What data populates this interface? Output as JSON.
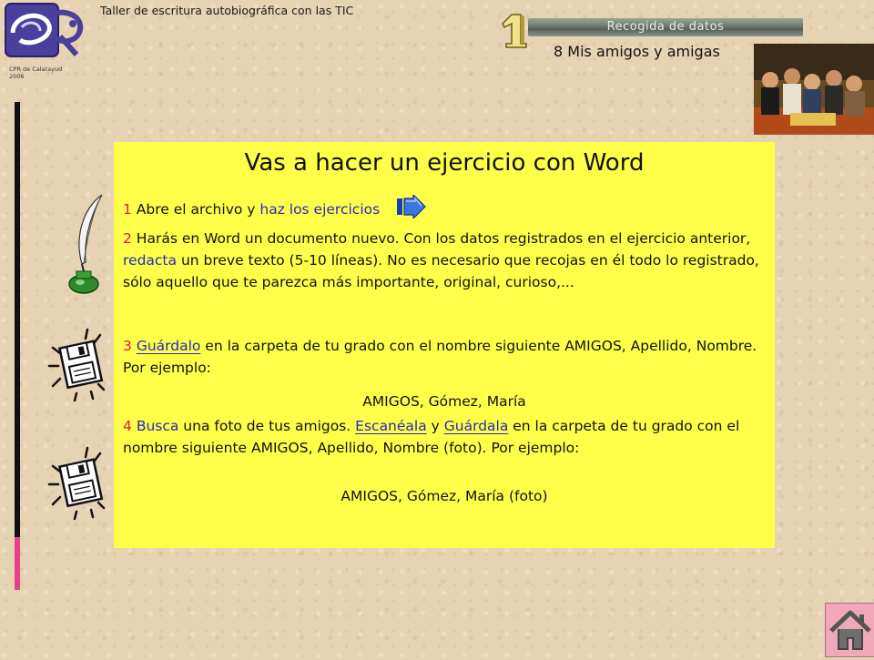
{
  "header": {
    "workshop_title": "Taller de escritura autobiográfica con las TIC",
    "org_line1": "CPR de Calatayud",
    "org_line2": "2006",
    "section_number": "1",
    "section_banner": "Recogida de datos",
    "slide_subtitle": "8 Mis amigos y amigas"
  },
  "panel": {
    "title": "Vas a hacer un ejercicio con Word",
    "step1": {
      "num": "1",
      "pre": " Abre el archivo y ",
      "link": "haz los ejercicios"
    },
    "step2": {
      "num": "2",
      "pre": " Harás en Word un documento nuevo.  Con los datos registrados en el ejercicio anterior, ",
      "link": "redacta",
      "post": " un breve texto (5-10 líneas). No es necesario que recojas en él todo lo registrado, sólo aquello que te parezca más importante, original, curioso,..."
    },
    "step3": {
      "num": "3",
      "link": "Guárdalo",
      "post": "  en la carpeta de tu grado con el nombre siguiente AMIGOS, Apellido, Nombre. Por ejemplo:",
      "example": "AMIGOS, Gómez, María"
    },
    "step4": {
      "num": "4",
      "link1": "Busca",
      "mid1": " una foto de tus amigos. ",
      "link2": "Escanéala",
      "mid2": " y ",
      "link3": "Guárdala",
      "post": "  en la carpeta de tu grado con el nombre siguiente AMIGOS, Apellido, Nombre (foto). Por ejemplo:",
      "example": "AMIGOS, Gómez, María (foto)"
    }
  },
  "icons": {
    "next_arrow": "next-arrow-icon",
    "quill": "quill-inkwell-icon",
    "floppy": "floppy-disk-icon",
    "home": "home-icon"
  },
  "colors": {
    "panel_bg": "#ffff4a",
    "step_number": "#e0174a",
    "link": "#2b28b8",
    "bar_dark": "#111111",
    "bar_accent": "#e8418a"
  }
}
